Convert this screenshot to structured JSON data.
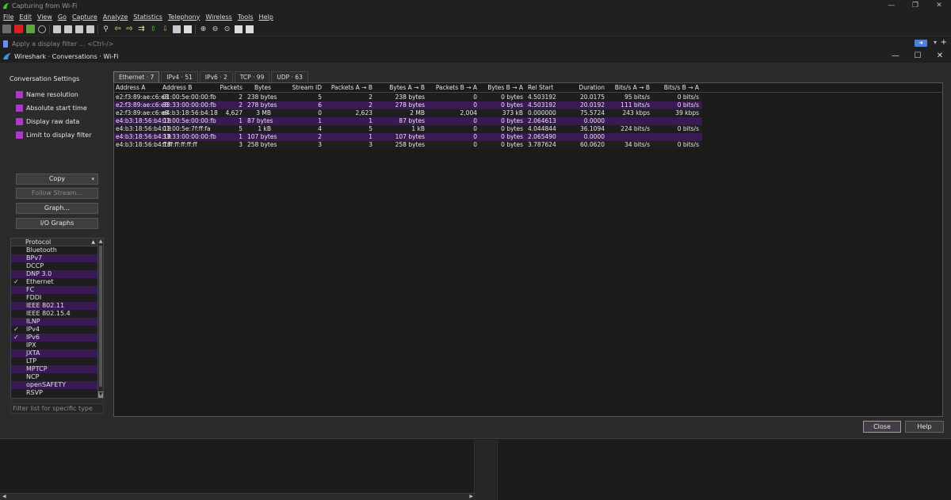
{
  "window": {
    "title": "Capturing from Wi-Fi",
    "controls": [
      "—",
      "❐",
      "✕"
    ]
  },
  "menu": [
    "File",
    "Edit",
    "View",
    "Go",
    "Capture",
    "Analyze",
    "Statistics",
    "Telephony",
    "Wireless",
    "Tools",
    "Help"
  ],
  "filter": {
    "placeholder": "Apply a display filter … <Ctrl-/>"
  },
  "dialog": {
    "title": "Wireshark · Conversations · Wi-Fi",
    "controls": [
      "—",
      "☐",
      "✕"
    ],
    "settings_title": "Conversation Settings",
    "settings": [
      {
        "label": "Name resolution",
        "checked": true
      },
      {
        "label": "Absolute start time",
        "checked": true
      },
      {
        "label": "Display raw data",
        "checked": true
      },
      {
        "label": "Limit to display filter",
        "checked": true
      }
    ],
    "buttons": {
      "copy": "Copy",
      "follow": "Follow Stream...",
      "graph": "Graph...",
      "io": "I/O Graphs"
    },
    "protocol_header": "Protocol",
    "protocols": [
      {
        "name": "Bluetooth",
        "checked": false
      },
      {
        "name": "BPv7",
        "checked": false
      },
      {
        "name": "DCCP",
        "checked": false
      },
      {
        "name": "DNP 3.0",
        "checked": false
      },
      {
        "name": "Ethernet",
        "checked": true
      },
      {
        "name": "FC",
        "checked": false
      },
      {
        "name": "FDDI",
        "checked": false
      },
      {
        "name": "IEEE 802.11",
        "checked": false
      },
      {
        "name": "IEEE 802.15.4",
        "checked": false
      },
      {
        "name": "ILNP",
        "checked": false
      },
      {
        "name": "IPv4",
        "checked": true
      },
      {
        "name": "IPv6",
        "checked": true
      },
      {
        "name": "IPX",
        "checked": false
      },
      {
        "name": "JXTA",
        "checked": false
      },
      {
        "name": "LTP",
        "checked": false
      },
      {
        "name": "MPTCP",
        "checked": false
      },
      {
        "name": "NCP",
        "checked": false
      },
      {
        "name": "openSAFETY",
        "checked": false
      },
      {
        "name": "RSVP",
        "checked": false
      }
    ],
    "filter_placeholder": "Filter list for specific type",
    "tabs": [
      "Ethernet · 7",
      "IPv4 · 51",
      "IPv6 · 2",
      "TCP · 99",
      "UDP · 63"
    ],
    "active_tab": 0,
    "columns": [
      "Address A",
      "Address B",
      "Packets",
      "Bytes",
      "Stream ID",
      "Packets A → B",
      "Bytes A → B",
      "Packets B → A",
      "Bytes B → A",
      "Rel Start",
      "Duration",
      "Bits/s A → B",
      "Bits/s B → A"
    ],
    "rows": [
      [
        "e2:f3:89:ae:c6:e8",
        "01:00:5e:00:00:fb",
        "2",
        "238 bytes",
        "5",
        "2",
        "238 bytes",
        "0",
        "0 bytes",
        "4.503192",
        "20.0175",
        "95 bits/s",
        "0 bits/s"
      ],
      [
        "e2:f3:89:ae:c6:e8",
        "33:33:00:00:00:fb",
        "2",
        "278 bytes",
        "6",
        "2",
        "278 bytes",
        "0",
        "0 bytes",
        "4.503192",
        "20.0192",
        "111 bits/s",
        "0 bits/s"
      ],
      [
        "e2:f3:89:ae:c6:e8",
        "e4:b3:18:56:b4:18",
        "4,627",
        "3 MB",
        "0",
        "2,623",
        "2 MB",
        "2,004",
        "373 kB",
        "0.000000",
        "75.5724",
        "243 kbps",
        "39 kbps"
      ],
      [
        "e4:b3:18:56:b4:18",
        "01:00:5e:00:00:fb",
        "1",
        "87 bytes",
        "1",
        "1",
        "87 bytes",
        "0",
        "0 bytes",
        "2.064613",
        "0.0000",
        "",
        ""
      ],
      [
        "e4:b3:18:56:b4:18",
        "01:00:5e:7f:ff:fa",
        "5",
        "1 kB",
        "4",
        "5",
        "1 kB",
        "0",
        "0 bytes",
        "4.044844",
        "36.1094",
        "224 bits/s",
        "0 bits/s"
      ],
      [
        "e4:b3:18:56:b4:18",
        "33:33:00:00:00:fb",
        "1",
        "107 bytes",
        "2",
        "1",
        "107 bytes",
        "0",
        "0 bytes",
        "2.065490",
        "0.0000",
        "",
        ""
      ],
      [
        "e4:b3:18:56:b4:18",
        "ff:ff:ff:ff:ff:ff",
        "3",
        "258 bytes",
        "3",
        "3",
        "258 bytes",
        "0",
        "0 bytes",
        "3.787624",
        "60.0620",
        "34 bits/s",
        "0 bits/s"
      ]
    ],
    "close": "Close",
    "help": "Help"
  }
}
